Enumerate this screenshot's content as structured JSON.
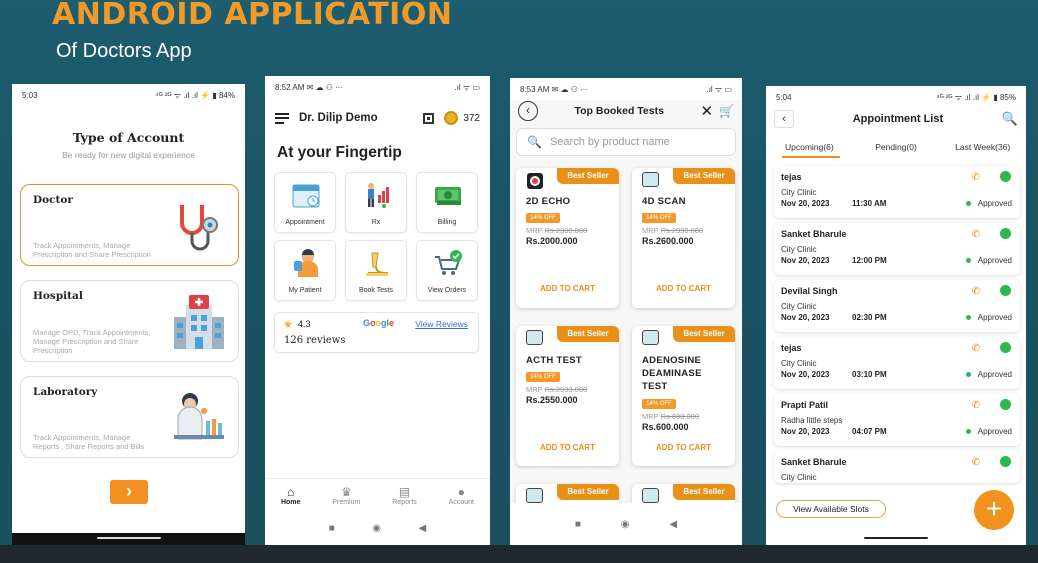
{
  "banner": {
    "title": "ANDROID APPLICATION",
    "subtitle": "Of Doctors App"
  },
  "phone1": {
    "time": "5:03",
    "status_icons": "⁴ᴳ ²ᴳ ᯤ .ıl .ıl ⚡ ▮ 84%",
    "title": "Type of Account",
    "subtitle": "Be ready for new digital experience",
    "accounts": [
      {
        "name": "Doctor",
        "desc": "Track Appointments, Manage Prescription and Share Prescription",
        "icon": "stethoscope-icon"
      },
      {
        "name": "Hospital",
        "desc": "Manage OPD, Track Appointments, Manage Prescription and Share Prescription",
        "icon": "hospital-icon"
      },
      {
        "name": "Laboratory",
        "desc": "Track Appointments, Manage Reports , Share Reports and Bills",
        "icon": "lab-scientist-icon"
      }
    ],
    "next_label": "›"
  },
  "phone2": {
    "time": "8:52 AM ✉ ☁ ⚇ ···",
    "status_icons": ".ıl ᯤ ▭",
    "doctor_name": "Dr. Dilip Demo",
    "coins": "372",
    "heading": "At your Fingertip",
    "tiles": [
      {
        "label": "Appointment",
        "icon": "calendar-icon"
      },
      {
        "label": "Rx",
        "icon": "prescription-icon"
      },
      {
        "label": "Billing",
        "icon": "money-icon"
      },
      {
        "label": "My Patient",
        "icon": "patient-icon"
      },
      {
        "label": "Book Tests",
        "icon": "microscope-icon"
      },
      {
        "label": "View Orders",
        "icon": "cart-check-icon"
      }
    ],
    "rating": "4.3",
    "google": "Google",
    "view_reviews": "View Reviews",
    "reviews": "126 reviews",
    "nav": [
      {
        "label": "Home",
        "icon": "home-icon"
      },
      {
        "label": "Premium",
        "icon": "premium-icon"
      },
      {
        "label": "Reports",
        "icon": "reports-icon"
      },
      {
        "label": "Account",
        "icon": "account-icon"
      }
    ]
  },
  "phone3": {
    "time": "8:53 AM ✉ ☁ ⚇ ···",
    "status_icons": ".ıl ᯤ ▭",
    "title": "Top Booked Tests",
    "search_placeholder": "Search by product name",
    "badge": "Best Seller",
    "off": "14% OFF",
    "add_label": "ADD TO CART",
    "tests": [
      {
        "name": "2D ECHO",
        "mrp_label": "MRP",
        "mrp": "Rs.2300.000",
        "price": "Rs.2000.000"
      },
      {
        "name": "4D SCAN",
        "mrp_label": "MRP",
        "mrp": "Rs.2990.000",
        "price": "Rs.2600.000"
      },
      {
        "name": "ACTH TEST",
        "mrp_label": "MRP",
        "mrp": "Rs.2933.000",
        "price": "Rs.2550.000"
      },
      {
        "name": "ADENOSINE DEAMINASE TEST",
        "mrp_label": "MRP",
        "mrp": "Rs.690.000",
        "price": "Rs.600.000"
      }
    ]
  },
  "phone4": {
    "time": "5:04",
    "status_icons": "⁴ᴳ ²ᴳ ᯤ .ıl .ıl ⚡ ▮ 85%",
    "title": "Appointment List",
    "tabs": [
      "Upcoming(6)",
      "Pending(0)",
      "Last Week(36)"
    ],
    "appointments": [
      {
        "name": "tejas",
        "clinic": "City Clinic",
        "date": "Nov 20, 2023",
        "time": "11:30 AM",
        "status": "Approved"
      },
      {
        "name": "Sanket Bharule",
        "clinic": "City Clinic",
        "date": "Nov 20, 2023",
        "time": "12:00 PM",
        "status": "Approved"
      },
      {
        "name": "Devilal Singh",
        "clinic": "City Clinic",
        "date": "Nov 20, 2023",
        "time": "02:30 PM",
        "status": "Approved"
      },
      {
        "name": "tejas",
        "clinic": "City Clinic",
        "date": "Nov 20, 2023",
        "time": "03:10 PM",
        "status": "Approved"
      },
      {
        "name": "Prapti Patil",
        "clinic": "Radha little steps",
        "date": "Nov 20, 2023",
        "time": "04:07 PM",
        "status": "Approved"
      },
      {
        "name": "Sanket Bharule",
        "clinic": "City Clinic",
        "date": "",
        "time": "",
        "status": ""
      }
    ],
    "slots_label": "View Available Slots",
    "fab_label": "+"
  }
}
